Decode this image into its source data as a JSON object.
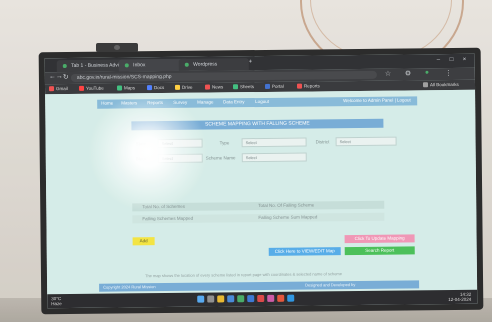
{
  "browser": {
    "tabs": [
      {
        "label": "Tab 1 - Business Advisory"
      },
      {
        "label": "Inbox"
      },
      {
        "label": "Wordpress"
      }
    ],
    "url": "abc.gov.in/rural-mission/SCS-mapping.php",
    "bookmarks": [
      "Gmail",
      "YouTube",
      "Maps",
      "Docs",
      "Drive",
      "News",
      "Sheets",
      "Portal",
      "Reports",
      "All Bookmarks"
    ]
  },
  "app": {
    "nav_items": [
      "Home",
      "Masters",
      "Reports",
      "Survey",
      "Manage",
      "Data Entry",
      "Logout"
    ],
    "user_info": "Welcome to Admin Panel | Logout",
    "panel_title": "SCHEME MAPPING WITH FALLING SCHEME",
    "filters": {
      "state_label": "State",
      "state_value": "Select",
      "type_label": "Type",
      "type_value": "Select",
      "district_label": "District",
      "district_value": "Select",
      "block_label": "Block",
      "block_value": "Select",
      "scheme_label": "Scheme Name",
      "scheme_value": "Select"
    },
    "summary": {
      "left_label_1": "Total No. of Schemes",
      "left_label_2": "Falling Schemes Mapped",
      "right_label_1": "Total No. Of Falling Scheme",
      "right_label_2": "Falling Scheme Sum Mapped"
    },
    "buttons": {
      "yellow": "Add",
      "pink": "Click To Update Mapping",
      "blue": "Click Here to VIEW/EDIT Map",
      "green": "Search Report"
    },
    "note": "The map shows the location of every scheme listed in report page with coordinates & selected name of scheme",
    "footer_left": "Copyright 2024 Rural Mission",
    "footer_right": "Designed and Developed by"
  },
  "taskbar": {
    "weather_temp": "30°C",
    "weather_desc": "Haze",
    "clock_time": "14:32",
    "clock_date": "12-04-2024"
  }
}
